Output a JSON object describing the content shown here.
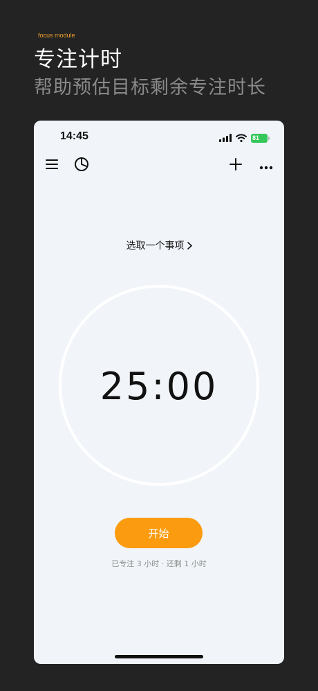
{
  "promo": {
    "tag": "focus module",
    "title": "专注计时",
    "subtitle": "帮助预估目标剩余专注时长"
  },
  "status_bar": {
    "time": "14:45",
    "battery": "81",
    "icons": [
      "signal-icon",
      "wifi-icon",
      "battery-icon"
    ]
  },
  "toolbar": {
    "icons": [
      "menu-icon",
      "pie-chart-icon",
      "plus-icon",
      "more-icon"
    ]
  },
  "task": {
    "label": "选取一个事项"
  },
  "timer": {
    "minutes": "25",
    "seconds": "00"
  },
  "start_label": "开始",
  "summary": "已专注 3 小时 · 还剩 1 小时",
  "colors": {
    "accent": "#fb9c10",
    "background": "#232323",
    "screen": "#f1f5fa",
    "tag": "#f0a030",
    "battery": "#34c759"
  }
}
